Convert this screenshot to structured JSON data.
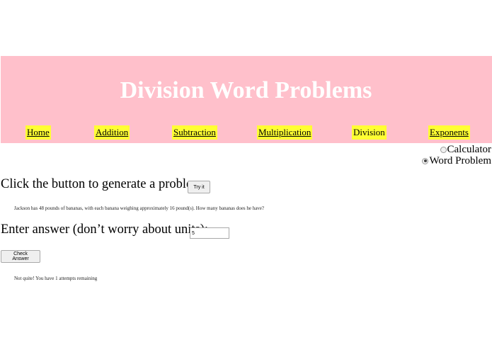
{
  "page": {
    "title": "Division Word Problems"
  },
  "nav": {
    "items": [
      {
        "label": "Home",
        "active": false
      },
      {
        "label": "Addition",
        "active": false
      },
      {
        "label": "Subtraction",
        "active": false
      },
      {
        "label": "Multiplication",
        "active": false
      },
      {
        "label": "Division",
        "active": true
      },
      {
        "label": "Exponents",
        "active": false
      }
    ]
  },
  "mode": {
    "options": [
      {
        "label": "Calculator",
        "selected": false
      },
      {
        "label": "Word Problem",
        "selected": true
      }
    ]
  },
  "generator": {
    "prompt": "Click the button to generate a problem.",
    "button_label": "Try it",
    "problem_text": "Jackson has 48 pounds of bananas, with each banana weighing approximately 16 pound(s). How many bananas does he have?"
  },
  "answer": {
    "prompt": "Enter answer (don’t worry about units):",
    "value": "5",
    "check_label": "Check Answer",
    "feedback": "Not quite! You have 1 attempts remaining"
  },
  "colors": {
    "header_bg": "#ffc0cb",
    "nav_bg": "#ffff33",
    "title_color": "#ffffff"
  }
}
